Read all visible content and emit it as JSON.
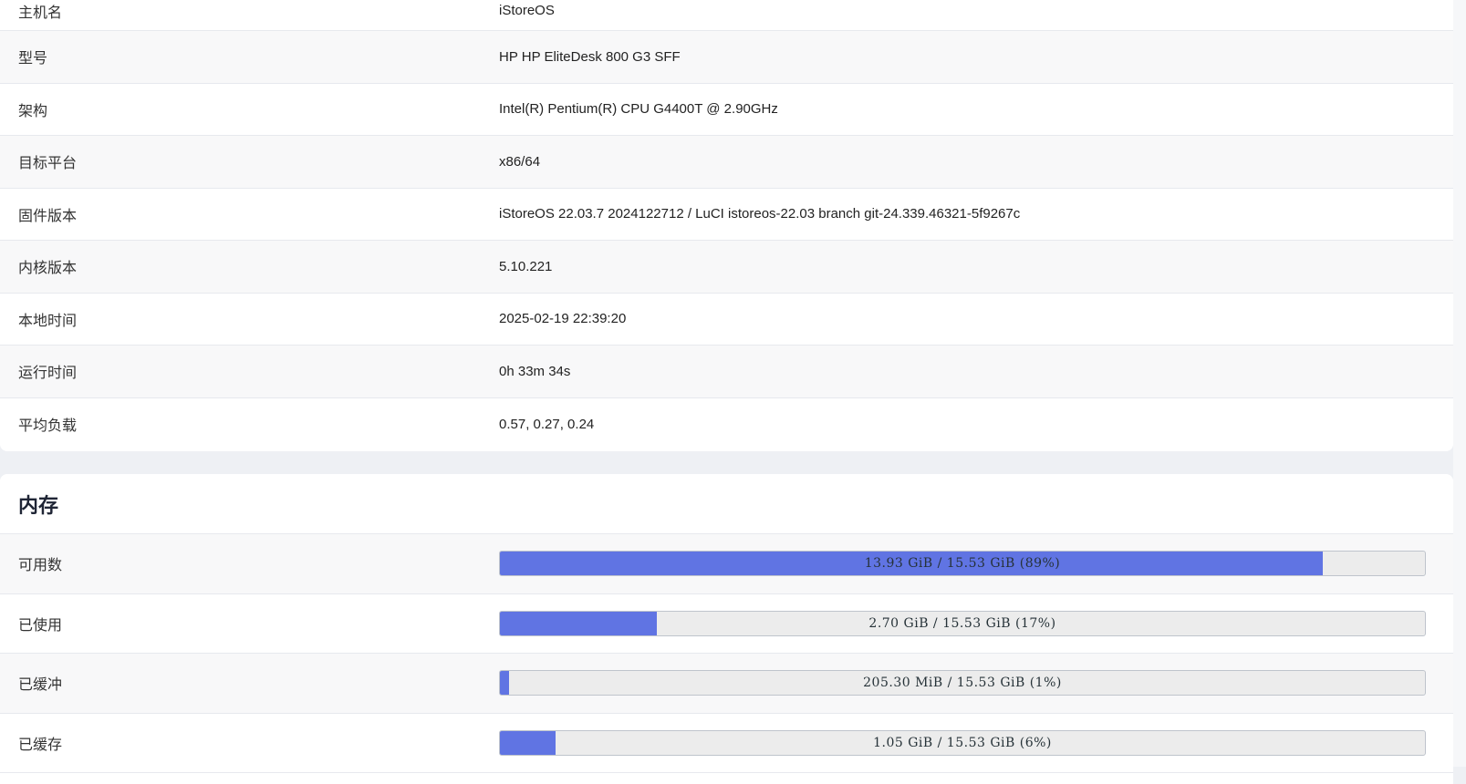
{
  "system": {
    "rows": [
      {
        "label": "主机名",
        "value": "iStoreOS"
      },
      {
        "label": "型号",
        "value": "HP HP EliteDesk 800 G3 SFF"
      },
      {
        "label": "架构",
        "value": "Intel(R) Pentium(R) CPU G4400T @ 2.90GHz"
      },
      {
        "label": "目标平台",
        "value": "x86/64"
      },
      {
        "label": "固件版本",
        "value": "iStoreOS 22.03.7 2024122712 / LuCI istoreos-22.03 branch git-24.339.46321-5f9267c"
      },
      {
        "label": "内核版本",
        "value": "5.10.221"
      },
      {
        "label": "本地时间",
        "value": "2025-02-19 22:39:20"
      },
      {
        "label": "运行时间",
        "value": "0h 33m 34s"
      },
      {
        "label": "平均负载",
        "value": "0.57, 0.27, 0.24"
      }
    ]
  },
  "memory": {
    "title": "内存",
    "rows": [
      {
        "label": "可用数",
        "text": "13.93 GiB / 15.53 GiB (89%)",
        "percent": 89
      },
      {
        "label": "已使用",
        "text": "2.70 GiB / 15.53 GiB (17%)",
        "percent": 17
      },
      {
        "label": "已缓冲",
        "text": "205.30 MiB / 15.53 GiB (1%)",
        "percent": 1
      },
      {
        "label": "已缓存",
        "text": "1.05 GiB / 15.53 GiB (6%)",
        "percent": 6
      }
    ]
  },
  "colors": {
    "progress_fill": "#6074e3",
    "progress_bg": "#ececec",
    "page_bg": "#eef0f4"
  }
}
